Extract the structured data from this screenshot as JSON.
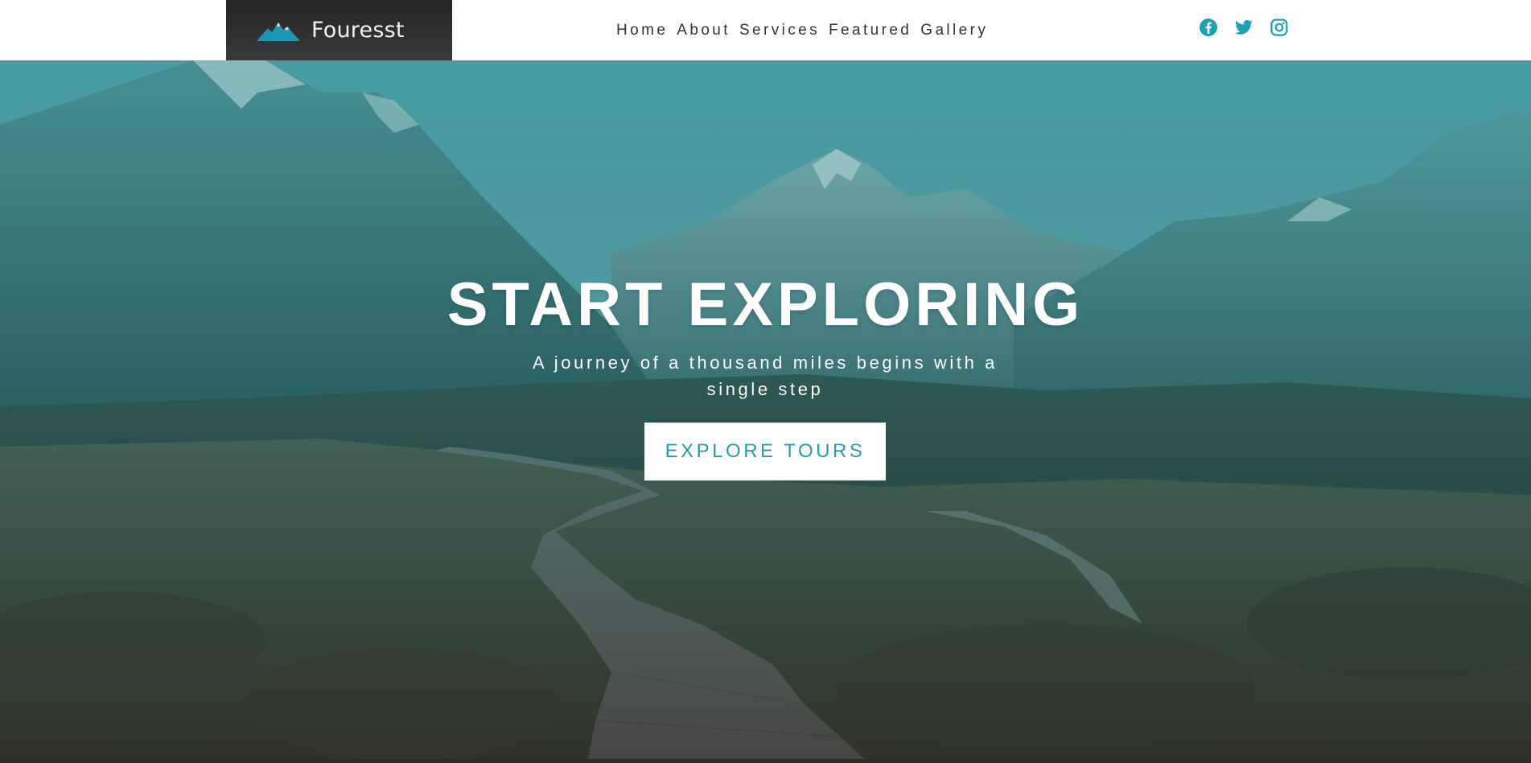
{
  "brand": {
    "name": "Fouresst",
    "logo_icon": "mountain-icon",
    "accent_color": "#1f95b5"
  },
  "nav": {
    "items": [
      {
        "label": "Home"
      },
      {
        "label": "About"
      },
      {
        "label": "Services"
      },
      {
        "label": "Featured"
      },
      {
        "label": "Gallery"
      }
    ]
  },
  "socials": {
    "color": "#1f9fb2",
    "icons": [
      "facebook-icon",
      "twitter-icon",
      "instagram-icon"
    ]
  },
  "hero": {
    "title": "START EXPLORING",
    "subtitle": "A journey of a thousand miles begins with a single step",
    "button_label": "EXPLORE TOURS",
    "button_text_color": "#2a9ca6"
  }
}
